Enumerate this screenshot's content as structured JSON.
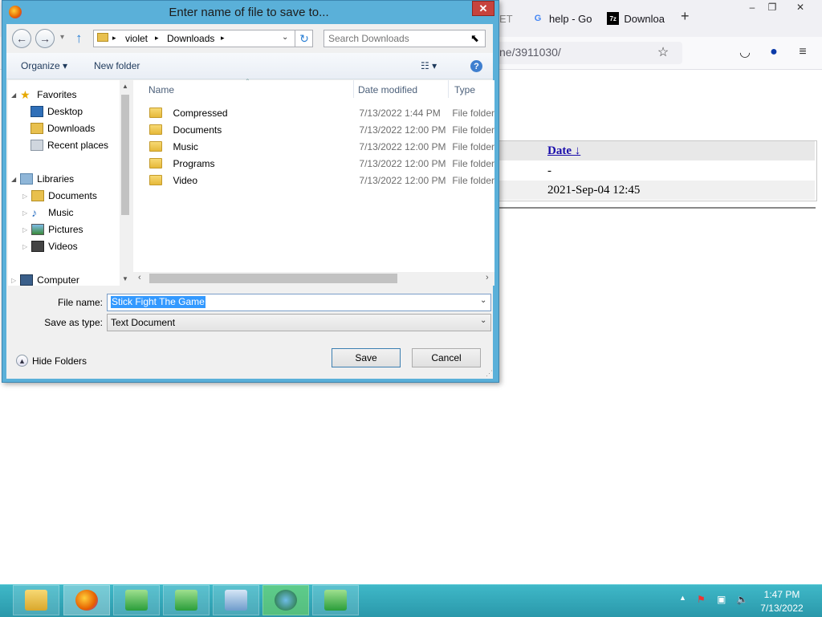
{
  "browser": {
    "tabs": [
      {
        "label": "ET",
        "icon": "partial-tab-icon"
      },
      {
        "label": "help - Go",
        "icon": "google-icon"
      },
      {
        "label": "Downloa",
        "icon": "7zip-icon"
      }
    ],
    "new_tab": "+",
    "window_controls": {
      "minimize": "–",
      "restore": "❐",
      "close": "✕"
    },
    "url": "ne/3911030/",
    "toolbar_icons": {
      "bookmark": "☆",
      "pocket": "◡",
      "account": "●",
      "menu": "≡"
    }
  },
  "page": {
    "table": {
      "header_date": "Date ↓",
      "rows": [
        "-",
        "2021-Sep-04 12:45"
      ]
    }
  },
  "dialog": {
    "title": "Enter name of file to save to...",
    "close": "✕",
    "nav": {
      "back": "←",
      "forward": "→",
      "recent": "▾",
      "up": "↑"
    },
    "breadcrumb": [
      "violet",
      "Downloads"
    ],
    "breadcrumb_sep": "▸",
    "refresh": "↻",
    "search_placeholder": "Search Downloads",
    "commands": {
      "organize": "Organize ▾",
      "new_folder": "New folder",
      "views": "☷ ▾",
      "help": "?"
    },
    "nav_pane": {
      "favorites": {
        "label": "Favorites",
        "items": [
          "Desktop",
          "Downloads",
          "Recent places"
        ]
      },
      "libraries": {
        "label": "Libraries",
        "items": [
          "Documents",
          "Music",
          "Pictures",
          "Videos"
        ]
      },
      "computer": "Computer"
    },
    "columns": {
      "name": "Name",
      "date": "Date modified",
      "type": "Type"
    },
    "files": [
      {
        "name": "Compressed",
        "date": "7/13/2022 1:44 PM",
        "type": "File folder"
      },
      {
        "name": "Documents",
        "date": "7/13/2022 12:00 PM",
        "type": "File folder"
      },
      {
        "name": "Music",
        "date": "7/13/2022 12:00 PM",
        "type": "File folder"
      },
      {
        "name": "Programs",
        "date": "7/13/2022 12:00 PM",
        "type": "File folder"
      },
      {
        "name": "Video",
        "date": "7/13/2022 12:00 PM",
        "type": "File folder"
      }
    ],
    "file_name_label": "File name:",
    "file_name_value": "Stick Fight The Game",
    "save_type_label": "Save as type:",
    "save_type_value": "Text Document",
    "hide_folders": "Hide Folders",
    "save": "Save",
    "cancel": "Cancel"
  },
  "taskbar": {
    "time": "1:47 PM",
    "date": "7/13/2022",
    "tray_arrow": "▲"
  }
}
